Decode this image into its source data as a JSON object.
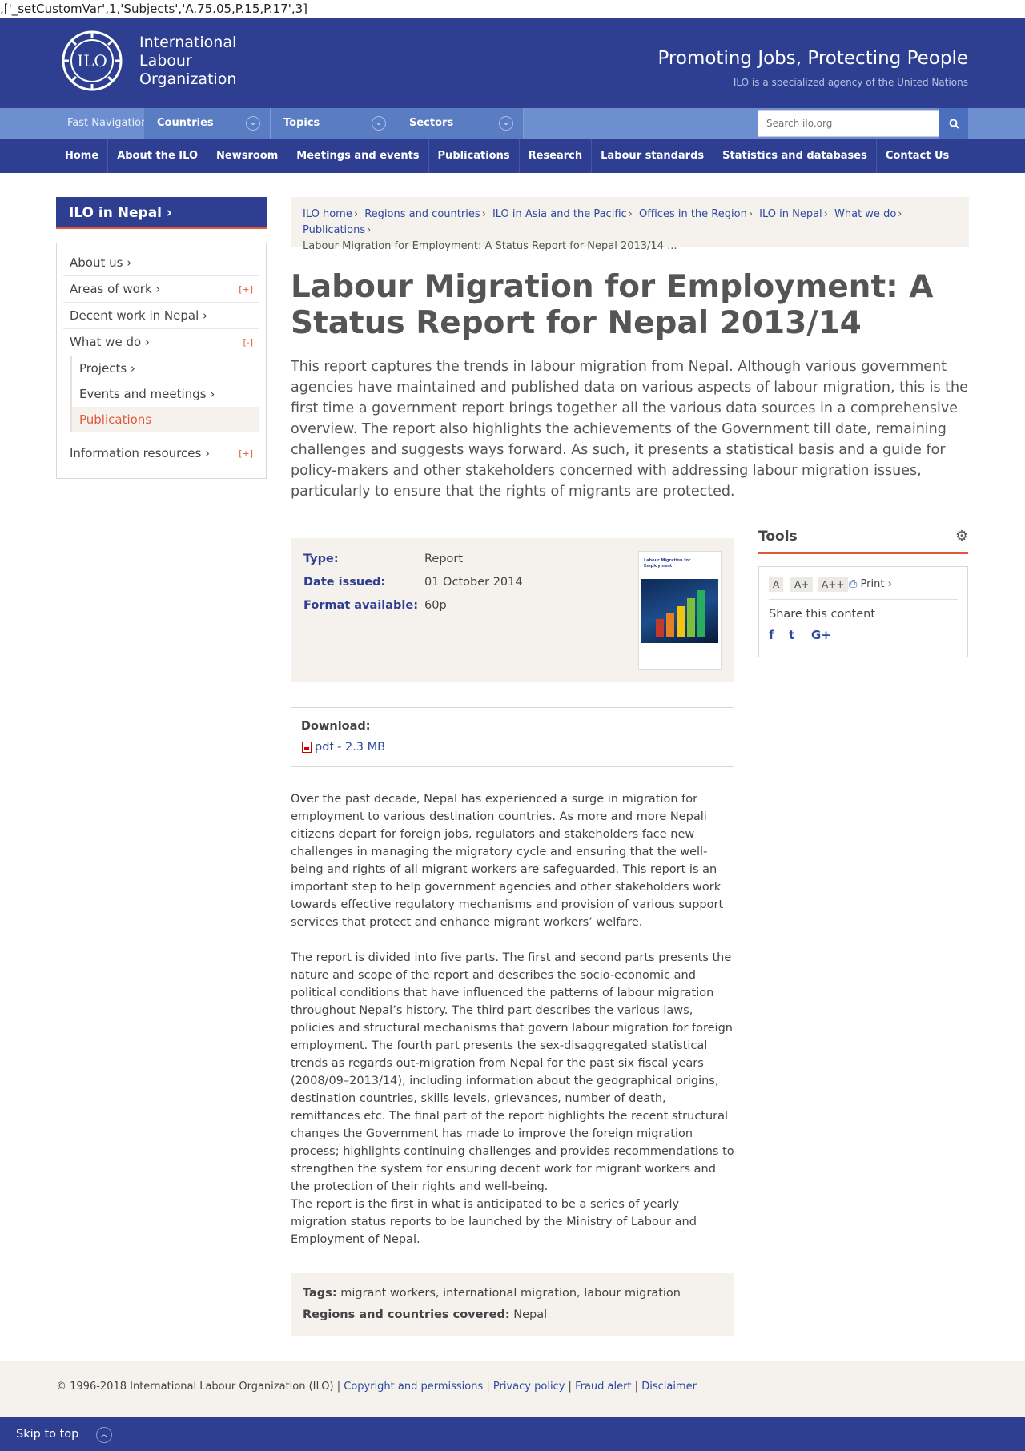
{
  "script_line": ",['_setCustomVar',1,'Subjects','A.75.05,P.15,P.17',3]",
  "header": {
    "logo_text_1": "International",
    "logo_text_2": "Labour",
    "logo_text_3": "Organization",
    "logo_mark_text": "ILO",
    "tagline": "Promoting Jobs, Protecting People",
    "tagline_sub": "ILO is a specialized agency of the United Nations"
  },
  "fastnav": {
    "label": "Fast Navigation:",
    "dropdowns": [
      "Countries",
      "Topics",
      "Sectors"
    ],
    "search_placeholder": "Search ilo.org"
  },
  "mainnav": [
    "Home",
    "About the ILO",
    "Newsroom",
    "Meetings and events",
    "Publications",
    "Research",
    "Labour standards",
    "Statistics and databases",
    "Contact Us"
  ],
  "sidebar": {
    "title": "ILO in Nepal ›",
    "items": [
      {
        "label": "About us ›",
        "toggle": ""
      },
      {
        "label": "Areas of work ›",
        "toggle": "[+]"
      },
      {
        "label": "Decent work in Nepal ›",
        "toggle": ""
      },
      {
        "label": "What we do ›",
        "toggle": "[-]"
      }
    ],
    "subitems": [
      "Projects ›",
      "Events and meetings ›",
      "Publications"
    ],
    "last_item": {
      "label": "Information resources ›",
      "toggle": "[+]"
    }
  },
  "breadcrumb": [
    "ILO home",
    "Regions and countries",
    "ILO in Asia and the Pacific",
    "Offices in the Region",
    "ILO in Nepal",
    "What we do",
    "Publications"
  ],
  "breadcrumb_current": "Labour Migration for Employment: A Status Report for Nepal 2013/14 ...",
  "title": "Labour Migration for Employment: A Status Report for Nepal 2013/14",
  "lead": "This report captures the trends in labour migration from Nepal. Although various government agencies have maintained and published data on various aspects of labour migration, this is the first time a government report brings together all the various data sources in a comprehensive overview. The report also highlights the achievements of the Government till date, remaining challenges and suggests ways forward. As such, it presents a statistical basis and a guide for policy-makers and other stakeholders concerned with addressing labour migration issues, particularly to ensure that the rights of migrants are protected.",
  "info": {
    "type_label": "Type:",
    "type_value": "Report",
    "date_label": "Date issued:",
    "date_value": "01 October 2014",
    "format_label": "Format available:",
    "format_value": "60p",
    "cover_title": "Labour Migration for Employment"
  },
  "tools": {
    "title": "Tools",
    "font_sizes": [
      "A",
      "A+",
      "A++"
    ],
    "print": "Print ›",
    "share_label": "Share this content",
    "share_icons": [
      "f",
      "t",
      "G+"
    ]
  },
  "download": {
    "label": "Download:",
    "link": "pdf - 2.3 MB"
  },
  "body": [
    "Over the past decade, Nepal has experienced a surge in migration for employment to various destination countries. As more and more Nepali citizens depart for foreign jobs, regulators and stakeholders face new challenges in managing the migratory cycle and ensuring that the well-being and rights of all migrant workers are safeguarded. This report is an important step to help government agencies and other stakeholders work towards effective regulatory mechanisms and provision of various support services that protect and enhance migrant workers’ welfare.",
    "The report is divided into five parts. The first and second parts presents the nature and scope of the report and describes the socio-economic and political conditions that have influenced the patterns of labour migration throughout Nepal’s history. The third part describes the various laws, policies and structural mechanisms that govern labour migration for foreign employment. The fourth part presents the sex-disaggregated statistical trends as regards out-migration from Nepal for the past six fiscal years (2008/09–2013/14), including information about the geographical origins, destination countries, skills levels, grievances, number of death, remittances etc. The final part of the report highlights the recent structural changes the Government has made to improve the foreign migration process; highlights continuing challenges and provides recommendations to strengthen the system for ensuring decent work for migrant workers and the protection of their rights and well-being.",
    "The report is the first in what is anticipated to be a series of yearly migration status reports to be launched by the Ministry of Labour and Employment of Nepal."
  ],
  "tags": {
    "tags_label": "Tags:",
    "tags_value": "migrant workers, international migration, labour migration",
    "regions_label": "Regions and countries covered:",
    "regions_value": "Nepal"
  },
  "footer": {
    "copyright": "© 1996-2018 International Labour Organization (ILO) |",
    "links": [
      "Copyright and permissions",
      "Privacy policy",
      "Fraud alert",
      "Disclaimer"
    ],
    "skip": "Skip to top"
  }
}
